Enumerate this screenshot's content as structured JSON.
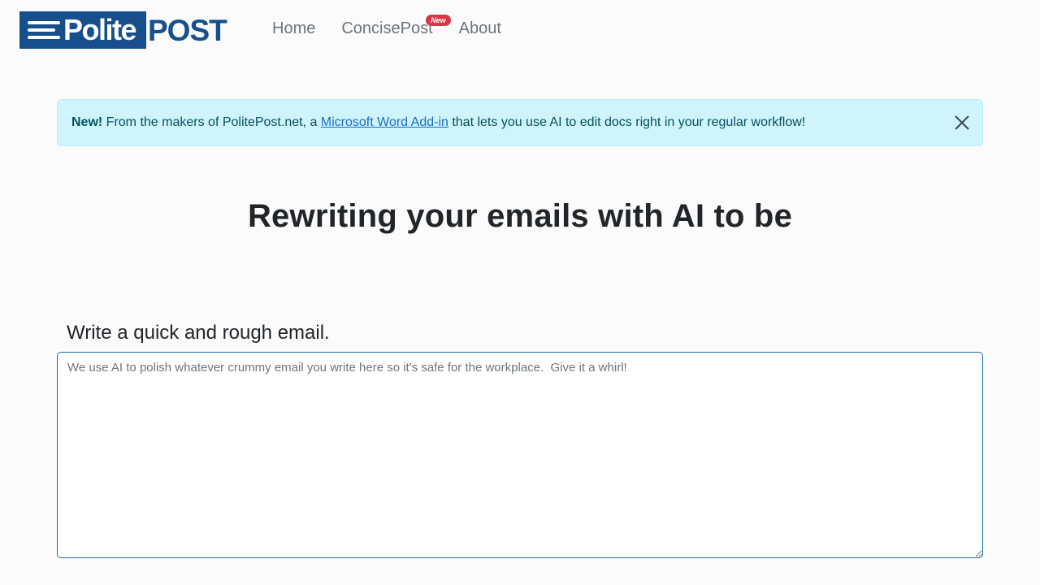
{
  "brand": {
    "name_part1": "Polite",
    "name_part2": "POST",
    "color": "#164f8c"
  },
  "nav": {
    "items": [
      {
        "label": "Home"
      },
      {
        "label": "ConcisePost",
        "badge": "New"
      },
      {
        "label": "About"
      }
    ]
  },
  "alert": {
    "strong": "New!",
    "text_before": " From the makers of PolitePost.net, a ",
    "link": "Microsoft Word Add-in",
    "text_after": " that lets you use AI to edit docs right in your regular workflow!",
    "close_icon": "close-icon"
  },
  "hero": {
    "title": "Rewriting your emails with AI to be"
  },
  "form": {
    "label": "Write a quick and rough email.",
    "placeholder": "We use AI to polish whatever crummy email you write here so it's safe for the workplace.  Give it a whirl!",
    "value": ""
  }
}
